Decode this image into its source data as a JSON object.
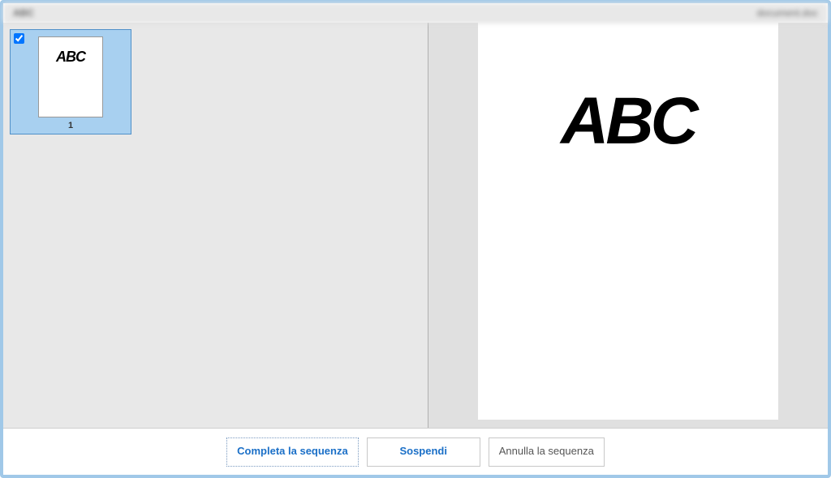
{
  "header": {
    "left": "ABC",
    "right": "document.doc"
  },
  "thumbnails": {
    "items": [
      {
        "page_number": "1",
        "content": "ABC",
        "checked": true
      }
    ]
  },
  "preview": {
    "content": "ABC"
  },
  "buttons": {
    "complete": "Completa la sequenza",
    "suspend": "Sospendi",
    "cancel": "Annulla la sequenza"
  }
}
